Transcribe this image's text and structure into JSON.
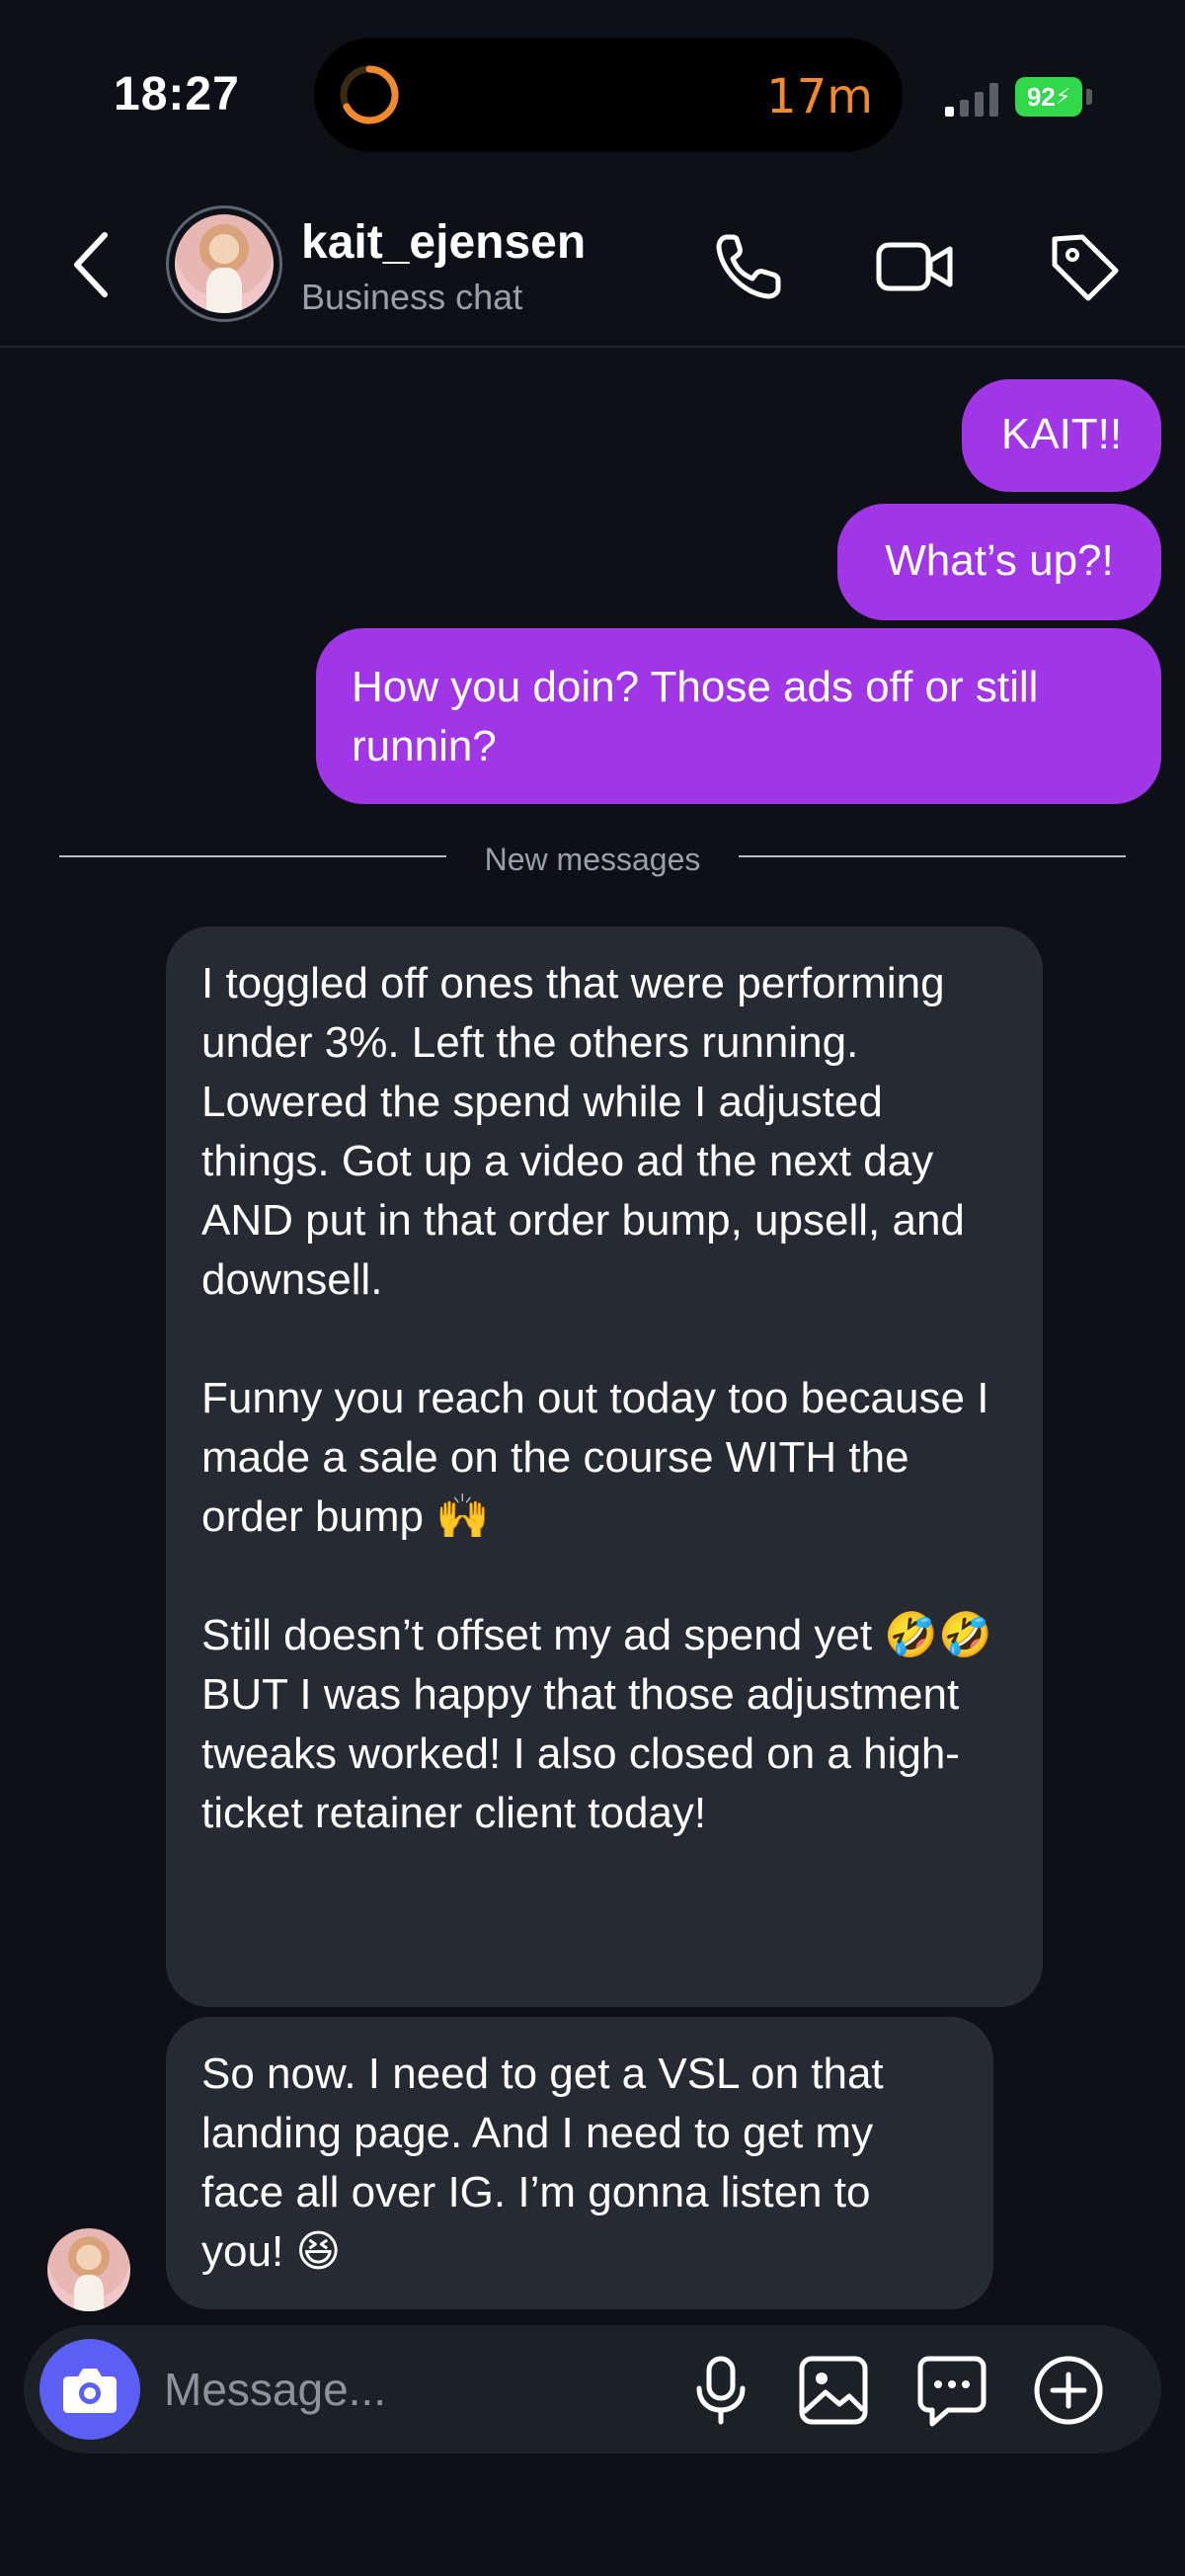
{
  "status_bar": {
    "time": "18:27",
    "timer": "17m",
    "battery": "92"
  },
  "header": {
    "contact_name": "kait_ejensen",
    "subtitle": "Business chat"
  },
  "messages_out": [
    "KAIT!!",
    "What’s up?!",
    "How you doin? Those ads off or still runnin?"
  ],
  "divider_label": "New messages",
  "messages_in": {
    "first": {
      "p1": "I toggled off ones that were performing under 3%. Left the others running. Lowered the spend while I adjusted things. Got up a video ad the next day AND put in that order bump, upsell, and downsell.",
      "p2": "Funny you reach out today too because I made a sale on the course WITH the order bump 🙌",
      "p3": "Still doesn’t offset my ad spend yet 🤣🤣 BUT I was happy that those adjustment tweaks worked! I also closed on a high-ticket retainer client today!"
    },
    "second": "So now. I need to get a VSL on that landing page. And I need to get my face all over IG. I’m gonna listen to you! 😆"
  },
  "composer": {
    "placeholder": "Message..."
  },
  "colors": {
    "background": "#0d1117",
    "outgoing_bubble": "#a136e6",
    "incoming_bubble": "#262a33",
    "camera_button": "#5b5ff5",
    "timer": "#f08a2c",
    "battery": "#32d74b"
  },
  "icons": [
    "back-chevron-icon",
    "phone-icon",
    "video-camera-icon",
    "tag-icon",
    "camera-icon",
    "microphone-icon",
    "image-icon",
    "sticker-chat-icon",
    "plus-circle-icon"
  ]
}
